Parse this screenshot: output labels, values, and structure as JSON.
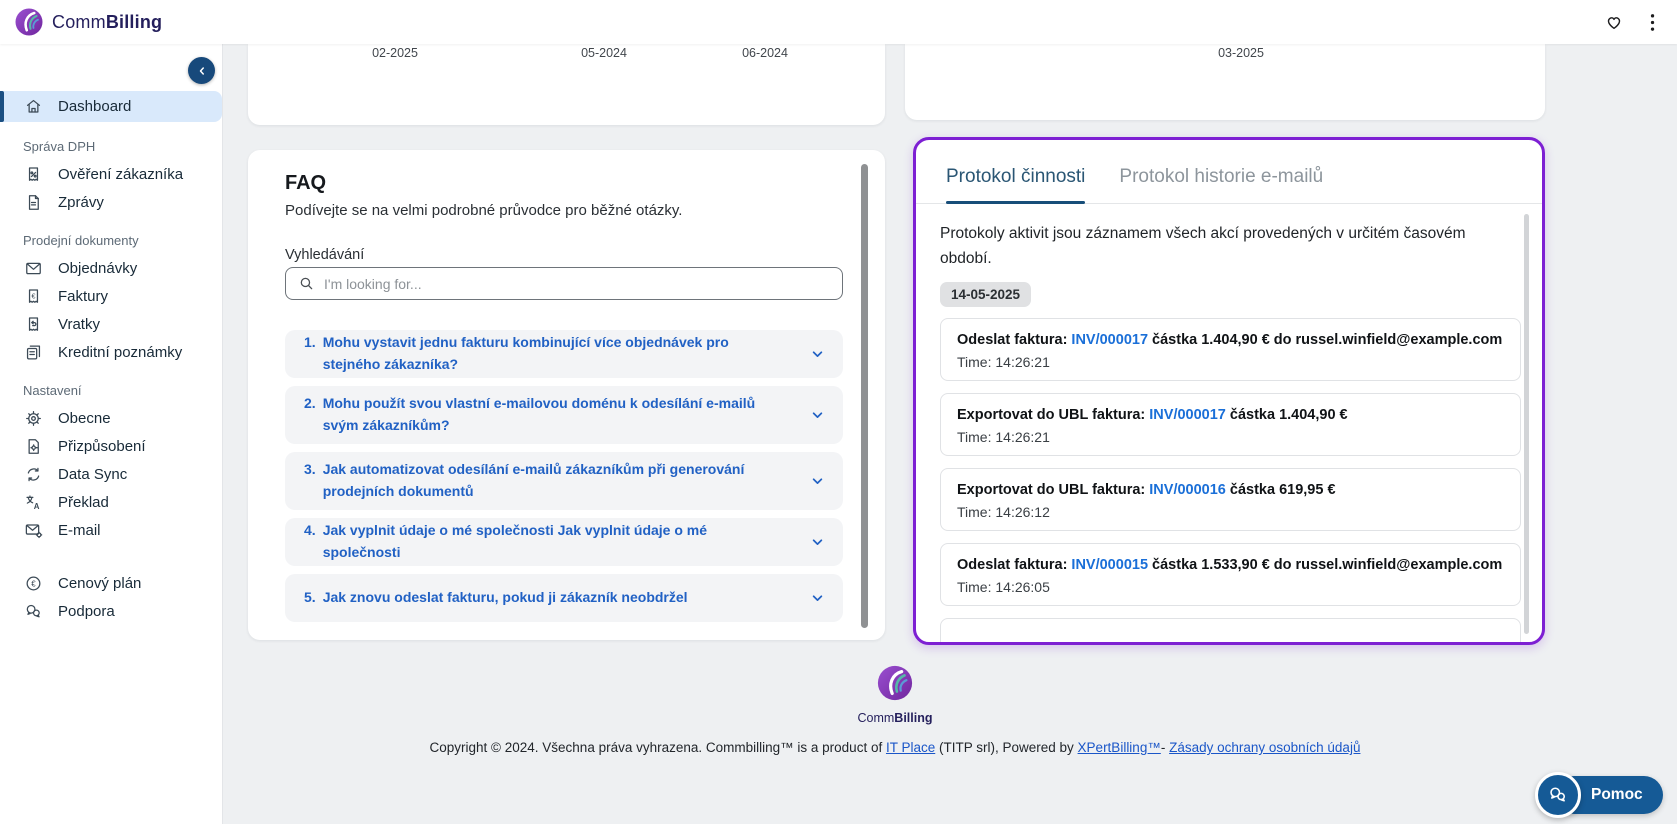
{
  "colors": {
    "accent_purple": "#7d1fd3",
    "link_blue": "#1a6fd8",
    "faq_blue": "#2161c4",
    "active_tab_blue": "#174e79",
    "primary_blue": "#155a96",
    "sidebar_active_bg": "#d9e9fb"
  },
  "header": {
    "brand_prefix": "Comm",
    "brand_suffix": "Billing"
  },
  "sidebar": {
    "groups": [
      {
        "label": "",
        "items": [
          {
            "label": "Dashboard",
            "icon": "home-icon",
            "active": true
          }
        ]
      },
      {
        "label": "Správa DPH",
        "items": [
          {
            "label": "Ověření zákazníka",
            "icon": "receipt-percent-icon"
          },
          {
            "label": "Zprávy",
            "icon": "document-icon"
          }
        ]
      },
      {
        "label": "Prodejní dokumenty",
        "items": [
          {
            "label": "Objednávky",
            "icon": "envelope-icon"
          },
          {
            "label": "Faktury",
            "icon": "invoice-euro-icon"
          },
          {
            "label": "Vratky",
            "icon": "return-receipt-icon"
          },
          {
            "label": "Kreditní poznámky",
            "icon": "credit-notes-icon"
          }
        ]
      },
      {
        "label": "Nastavení",
        "items": [
          {
            "label": "Obecne",
            "icon": "gear-icon"
          },
          {
            "label": "Přizpůsobení",
            "icon": "document-gear-icon"
          },
          {
            "label": "Data Sync",
            "icon": "sync-icon"
          },
          {
            "label": "Překlad",
            "icon": "translate-icon"
          },
          {
            "label": "E-mail",
            "icon": "mail-gear-icon"
          }
        ]
      },
      {
        "label": "",
        "items": [
          {
            "label": "Cenový plán",
            "icon": "euro-circle-icon"
          },
          {
            "label": "Podpora",
            "icon": "support-chat-icon"
          }
        ]
      }
    ]
  },
  "charts": {
    "left_x_labels": [
      "02-2025",
      "05-2024",
      "06-2024"
    ],
    "right_x_label": "03-2025"
  },
  "faq": {
    "title": "FAQ",
    "subtitle": "Podívejte se na velmi podrobné průvodce pro běžné otázky.",
    "search_label": "Vyhledávání",
    "search_placeholder": "I'm looking for...",
    "items": [
      {
        "num": "1.",
        "q": "Mohu vystavit jednu fakturu kombinující více objednávek pro stejného zákazníka?"
      },
      {
        "num": "2.",
        "q": "Mohu použít svou vlastní e-mailovou doménu k odesílání e-mailů svým zákazníkům?"
      },
      {
        "num": "3.",
        "q": "Jak automatizovat odesílání e-mailů zákazníkům při generování prodejních dokumentů"
      },
      {
        "num": "4.",
        "q": "Jak vyplnit údaje o mé společnosti Jak vyplnit údaje o mé společnosti"
      },
      {
        "num": "5.",
        "q": "Jak znovu odeslat fakturu, pokud ji zákazník neobdržel"
      }
    ]
  },
  "activity": {
    "tabs": [
      {
        "label": "Protokol činnosti",
        "active": true
      },
      {
        "label": "Protokol historie e-mailů",
        "active": false
      }
    ],
    "description": "Protokoly aktivit jsou záznamem všech akcí provedených v určitém časovém období.",
    "date_badge": "14-05-2025",
    "entries": [
      {
        "prefix": "Odeslat faktura: ",
        "invoice": "INV/000017",
        "suffix": " částka 1.404,90 € do russel.winfield@example.com",
        "time": "Time: 14:26:21"
      },
      {
        "prefix": "Exportovat do UBL faktura: ",
        "invoice": "INV/000017",
        "suffix": " částka 1.404,90 €",
        "time": "Time: 14:26:21"
      },
      {
        "prefix": "Exportovat do UBL faktura: ",
        "invoice": "INV/000016",
        "suffix": " částka 619,95 €",
        "time": "Time: 14:26:12"
      },
      {
        "prefix": "Odeslat faktura: ",
        "invoice": "INV/000015",
        "suffix": " částka 1.533,90 € do russel.winfield@example.com",
        "time": "Time: 14:26:05"
      }
    ]
  },
  "footer": {
    "brand_prefix": "Comm",
    "brand_suffix": "Billing",
    "copyright_1": "Copyright © 2024. Všechna práva vyhrazena. Commbilling™ is a product of ",
    "link_itplace": "IT Place",
    "copyright_2": " (TITP srl), Powered by ",
    "link_xpert": "XPertBilling™",
    "copyright_3": "- ",
    "link_privacy": "Zásady ochrany osobních údajů"
  },
  "help": {
    "label": "Pomoc"
  }
}
